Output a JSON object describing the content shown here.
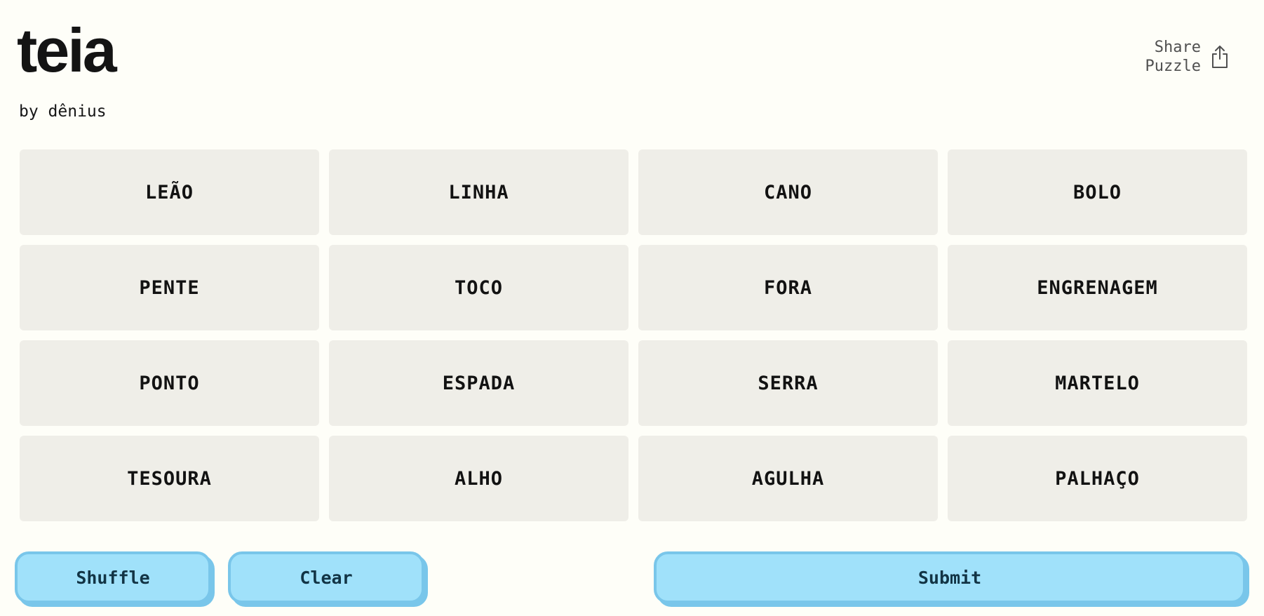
{
  "header": {
    "title": "teia",
    "byline": "by dênius",
    "share_line1": "Share",
    "share_line2": "Puzzle",
    "share_icon": "share-icon"
  },
  "grid": {
    "tiles": [
      "LEÃO",
      "LINHA",
      "CANO",
      "BOLO",
      "PENTE",
      "TOCO",
      "FORA",
      "ENGRENAGEM",
      "PONTO",
      "ESPADA",
      "SERRA",
      "MARTELO",
      "TESOURA",
      "ALHO",
      "AGULHA",
      "PALHAÇO"
    ]
  },
  "controls": {
    "shuffle_label": "Shuffle",
    "clear_label": "Clear",
    "submit_label": "Submit"
  },
  "colors": {
    "background": "#fefef8",
    "tile": "#efeee8",
    "button": "#a0e1fa",
    "button_border": "#79c6ea",
    "button_text": "#123445"
  }
}
